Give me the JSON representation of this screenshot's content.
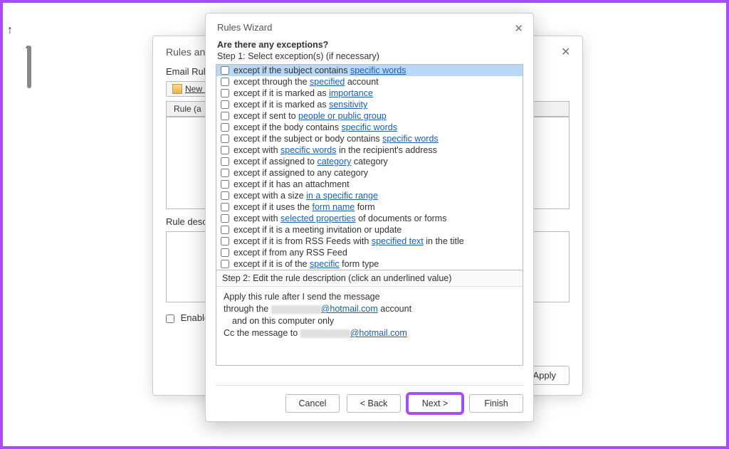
{
  "backDialog": {
    "title": "Rules and A",
    "emailRulesLabel": "Email Rules",
    "newRuleLabel": "New R",
    "ruleColumnLabel": "Rule (a",
    "ruleDescLabel": "Rule descr",
    "enableLabel": "Enable",
    "applyLabel": "Apply"
  },
  "wizard": {
    "title": "Rules Wizard",
    "question": "Are there any exceptions?",
    "step1Label": "Step 1: Select exception(s) (if necessary)",
    "step2Label": "Step 2: Edit the rule description (click an underlined value)",
    "exceptions": [
      {
        "pre": "except if the subject contains ",
        "link": "specific words",
        "post": "",
        "selected": true
      },
      {
        "pre": "except through the ",
        "link": "specified",
        "post": " account"
      },
      {
        "pre": "except if it is marked as ",
        "link": "importance",
        "post": ""
      },
      {
        "pre": "except if it is marked as ",
        "link": "sensitivity",
        "post": ""
      },
      {
        "pre": "except if sent to ",
        "link": "people or public group",
        "post": ""
      },
      {
        "pre": "except if the body contains ",
        "link": "specific words",
        "post": ""
      },
      {
        "pre": "except if the subject or body contains ",
        "link": "specific words",
        "post": ""
      },
      {
        "pre": "except with ",
        "link": "specific words",
        "post": " in the recipient's address"
      },
      {
        "pre": "except if assigned to ",
        "link": "category",
        "post": " category"
      },
      {
        "pre": "except if assigned to any category",
        "link": "",
        "post": ""
      },
      {
        "pre": "except if it has an attachment",
        "link": "",
        "post": ""
      },
      {
        "pre": "except with a size ",
        "link": "in a specific range",
        "post": ""
      },
      {
        "pre": "except if it uses the ",
        "link": "form name",
        "post": " form"
      },
      {
        "pre": "except with ",
        "link": "selected properties",
        "post": " of documents or forms"
      },
      {
        "pre": "except if it is a meeting invitation or update",
        "link": "",
        "post": ""
      },
      {
        "pre": "except if it is from RSS Feeds with ",
        "link": "specified text",
        "post": " in the title"
      },
      {
        "pre": "except if from any RSS Feed",
        "link": "",
        "post": ""
      },
      {
        "pre": "except if it is of the ",
        "link": "specific",
        "post": " form type"
      }
    ],
    "desc": {
      "line1": "Apply this rule after I send the message",
      "line2a": "through the ",
      "line2b": "@hotmail.com",
      "line2c": " account",
      "line3": "and on this computer only",
      "line4a": "Cc the message to ",
      "line4b": "@hotmail.com"
    },
    "buttons": {
      "cancel": "Cancel",
      "back": "< Back",
      "next": "Next >",
      "finish": "Finish"
    }
  }
}
